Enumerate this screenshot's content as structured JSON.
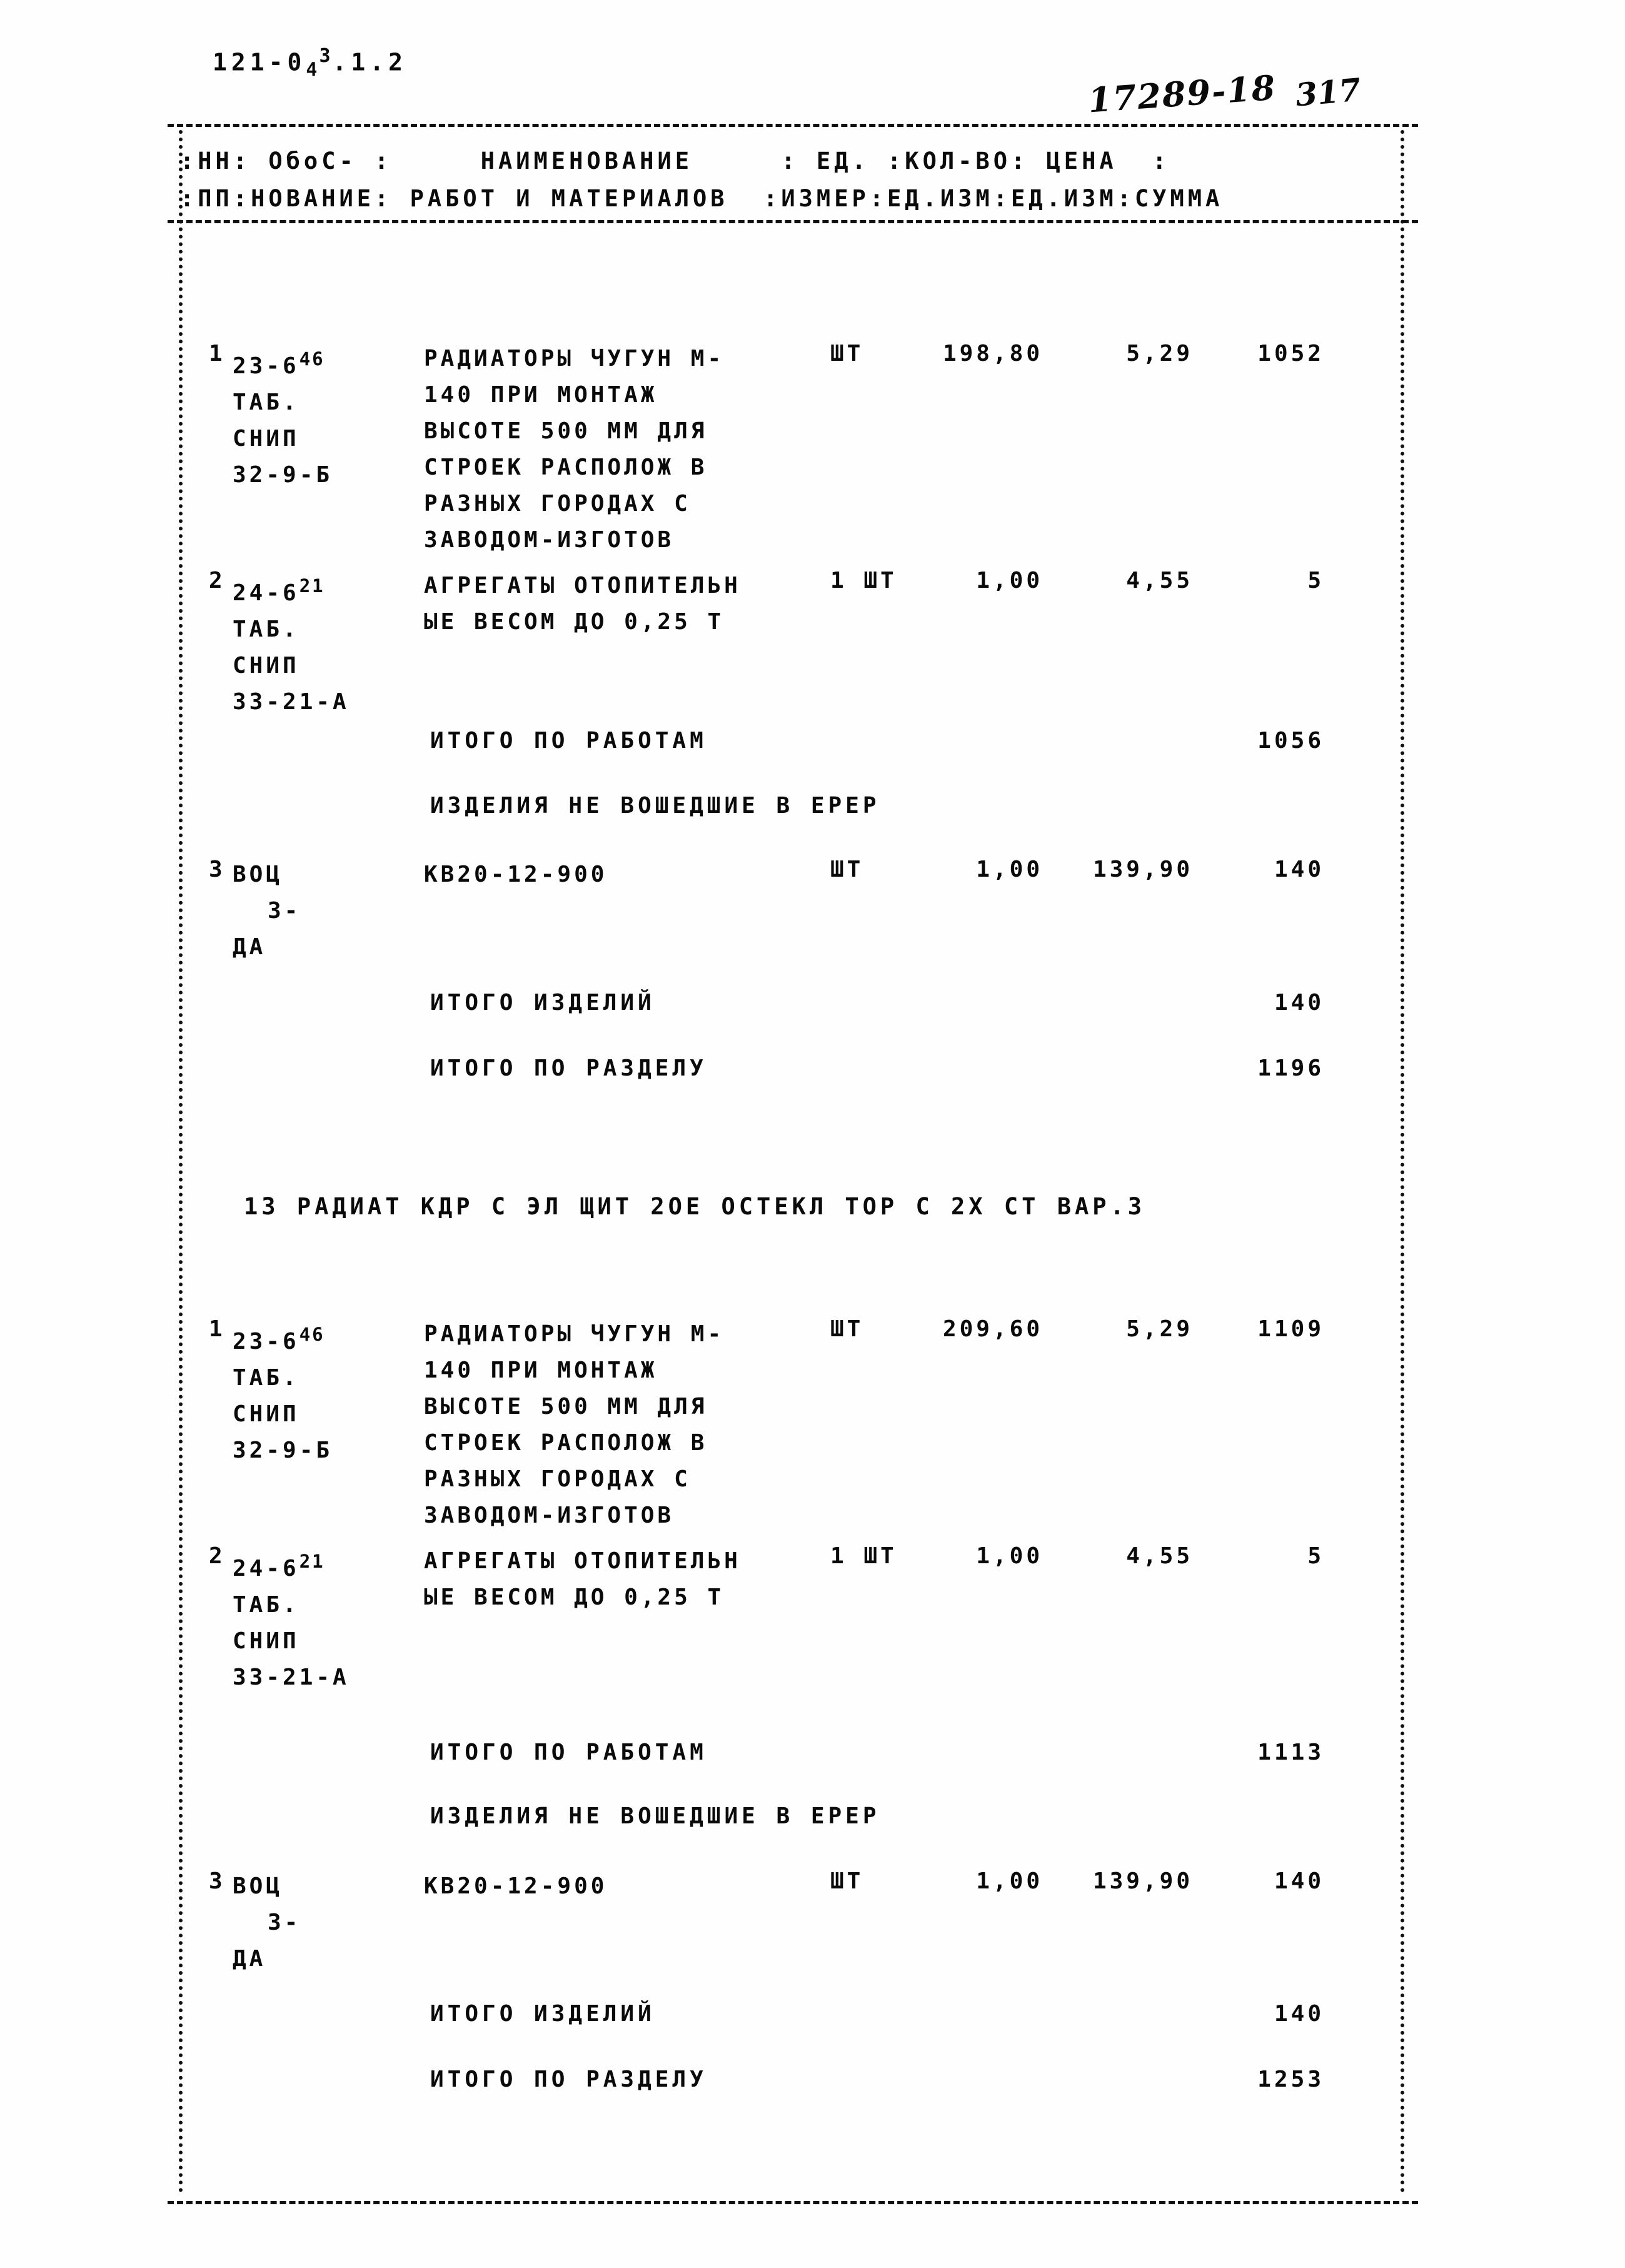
{
  "document": {
    "code_prefix": "121-0",
    "code_sub": "4",
    "code_sup": "3",
    "code_suffix": ".1.2",
    "code_full": "121-043.1.2",
    "handwritten_number": "17289-18",
    "page_number": "317"
  },
  "table_header": {
    "line1": ":НН: ОбоС- :     НАИМЕНОВАНИЕ     : ЕД. :КОЛ-ВО: ЦЕНА  :",
    "line2": ":ПП:НОВАНИЕ: РАБОТ И МАТЕРИАЛОВ  :ИЗМЕР:ЕД.ИЗМ:ЕД.ИЗМ:СУММА",
    "columns": [
      "НН ПП",
      "ОбоС-НОВАНИЕ",
      "НАИМЕНОВАНИЕ РАБОТ И МАТЕРИАЛОВ",
      "ЕД. ИЗМЕР",
      "КОЛ-ВО ЕД.ИЗМ",
      "ЦЕНА ЕД.ИЗМ",
      "СУММА"
    ]
  },
  "sections": [
    {
      "id": "section-1",
      "title": "",
      "rows": [
        {
          "num": "1",
          "code_main": "23-6",
          "code_sub": "6",
          "code_sup": "46",
          "code_lines": [
            "23-6 46",
            "ТАБ.",
            "СНИП",
            "32-9-Б"
          ],
          "code_extra": [
            "ТАБ.",
            "СНИП",
            "32-9-Б"
          ],
          "desc": [
            "РАДИАТОРЫ ЧУГУН М-",
            "140 ПРИ МОНТАЖ",
            "ВЫСОТЕ 500 ММ ДЛЯ",
            "СТРОЕК РАСПОЛОЖ В",
            "РАЗНЫХ ГОРОДАХ С",
            "ЗАВОДОМ-ИЗГОТОВ"
          ],
          "unit": "ШТ",
          "qty": "198,80",
          "price": "5,29",
          "sum_prefix": "1",
          "sum_rest": "052",
          "sum": "1052"
        },
        {
          "num": "2",
          "code_main": "24-6",
          "code_sub": "6",
          "code_sup": "21",
          "code_extra": [
            "ТАБ.",
            "СНИП",
            "33-21-А"
          ],
          "desc": [
            "АГРЕГАТЫ ОТОПИТЕЛЬН",
            "ЫЕ ВЕСОМ ДО 0,25 Т"
          ],
          "unit": "1 ШТ",
          "qty": "1,00",
          "price": "4,55",
          "sum_prefix": "",
          "sum_rest": "5",
          "sum": "5"
        }
      ],
      "total_works_label": "ИТОГО ПО РАБОТАМ",
      "total_works_value": "1056",
      "total_works_prefix": "1",
      "total_works_rest": "056",
      "not_included_label": "ИЗДЕЛИЯ НЕ ВОШЕДШИЕ В ЕРЕР",
      "extra_rows": [
        {
          "num": "3",
          "code_main": "ВОЦ",
          "code_extra": [
            "З-",
            "ДА"
          ],
          "desc": [
            "КВ20-12-900"
          ],
          "unit": "ШТ",
          "qty": "1,00",
          "price": "139,90",
          "sum": "140"
        }
      ],
      "total_items_label": "ИТОГО ИЗДЕЛИЙ",
      "total_items_value": "140",
      "total_section_label": "ИТОГО ПО РАЗДЕЛУ",
      "total_section_value": "1196",
      "total_section_prefix": "1",
      "total_section_rest": "196"
    },
    {
      "id": "section-2",
      "title": "13 РАДИАТ КДР С ЭЛ ЩИТ 2ОЕ ОСТЕКЛ ТОР С 2Х СТ ВАР.3",
      "rows": [
        {
          "num": "1",
          "code_main": "23-6",
          "code_sub": "6",
          "code_sup": "46",
          "code_extra": [
            "ТАБ.",
            "СНИП",
            "32-9-Б"
          ],
          "desc": [
            "РАДИАТОРЫ ЧУГУН М-",
            "140 ПРИ МОНТАЖ",
            "ВЫСОТЕ 500 ММ ДЛЯ",
            "СТРОЕК РАСПОЛОЖ В",
            "РАЗНЫХ ГОРОДАХ С",
            "ЗАВОДОМ-ИЗГОТОВ"
          ],
          "unit": "ШТ",
          "qty": "209,60",
          "price": "5,29",
          "sum_prefix": "1",
          "sum_rest": "109",
          "sum": "1109"
        },
        {
          "num": "2",
          "code_main": "24-6",
          "code_sub": "6",
          "code_sup": "21",
          "code_extra": [
            "ТАБ.",
            "СНИП",
            "33-21-А"
          ],
          "desc": [
            "АГРЕГАТЫ ОТОПИТЕЛЬН",
            "ЫЕ ВЕСОМ ДО 0,25 Т"
          ],
          "unit": "1 ШТ",
          "qty": "1,00",
          "price": "4,55",
          "sum_prefix": "",
          "sum_rest": "5",
          "sum": "5"
        }
      ],
      "total_works_label": "ИТОГО ПО РАБОТАМ",
      "total_works_value": "1113",
      "total_works_prefix": "1",
      "total_works_rest": "113",
      "not_included_label": "ИЗДЕЛИЯ НЕ ВОШЕДШИЕ В ЕРЕР",
      "extra_rows": [
        {
          "num": "3",
          "code_main": "ВОЦ",
          "code_extra": [
            "З-",
            "ДА"
          ],
          "desc": [
            "КВ20-12-900"
          ],
          "unit": "ШТ",
          "qty": "1,00",
          "price": "139,90",
          "sum": "140"
        }
      ],
      "total_items_label": "ИТОГО ИЗДЕЛИЙ",
      "total_items_value": "140",
      "total_section_label": "ИТОГО ПО РАЗДЕЛУ",
      "total_section_value": "1253",
      "total_section_prefix": "1",
      "total_section_rest": "253"
    }
  ]
}
